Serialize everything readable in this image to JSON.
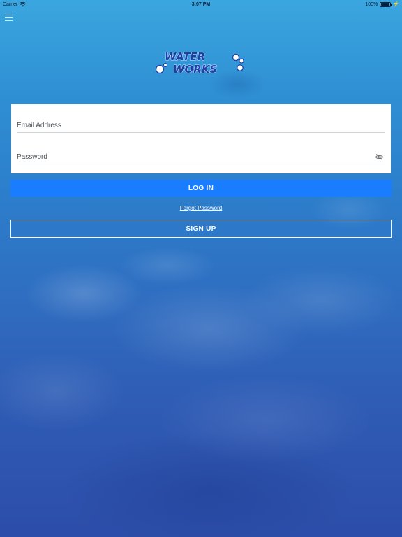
{
  "status_bar": {
    "carrier": "Carrier",
    "time": "3:07 PM",
    "battery_percent": "100%",
    "battery_level": 1.0
  },
  "header": {
    "menu_icon": "hamburger-menu-icon"
  },
  "logo": {
    "line1": "WATER",
    "line2": "WORKS"
  },
  "form": {
    "email_placeholder": "Email Address",
    "email_value": "",
    "password_placeholder": "Password",
    "password_value": "",
    "visibility_icon": "eye-slash-icon"
  },
  "actions": {
    "login_label": "LOG IN",
    "forgot_label": "Forgot Password",
    "signup_label": "SIGN UP"
  },
  "colors": {
    "primary_button": "#1a7cff",
    "background_top": "#3aa6df",
    "background_bottom": "#2c4da9",
    "logo_text": "#1f3fa8"
  }
}
